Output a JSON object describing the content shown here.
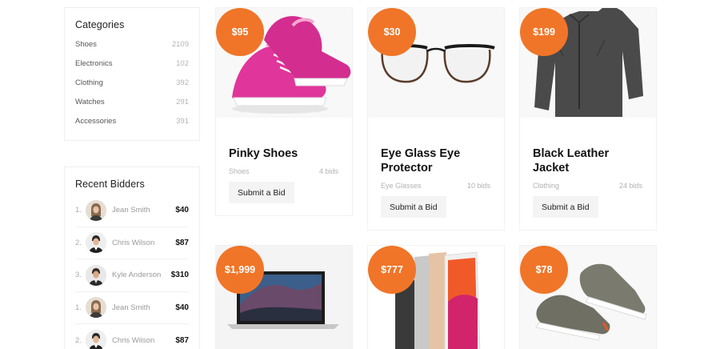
{
  "categories": {
    "title": "Categories",
    "items": [
      {
        "label": "Shoes",
        "count": "2109"
      },
      {
        "label": "Electronics",
        "count": "102"
      },
      {
        "label": "Clothing",
        "count": "392"
      },
      {
        "label": "Watches",
        "count": "291"
      },
      {
        "label": "Accessories",
        "count": "391"
      }
    ]
  },
  "recent_bidders": {
    "title": "Recent Bidders",
    "items": [
      {
        "rank": "1.",
        "name": "Jean Smith",
        "amount": "$40"
      },
      {
        "rank": "2.",
        "name": "Chris Wilson",
        "amount": "$87"
      },
      {
        "rank": "3.",
        "name": "Kyle Anderson",
        "amount": "$310"
      },
      {
        "rank": "1.",
        "name": "Jean Smith",
        "amount": "$40"
      },
      {
        "rank": "2.",
        "name": "Chris Wilson",
        "amount": "$87"
      }
    ]
  },
  "products": [
    {
      "price": "$95",
      "title": "Pinky Shoes",
      "category": "Shoes",
      "bids": "4 bids",
      "button": "Submit a Bid",
      "image_icon": "pink-sneakers"
    },
    {
      "price": "$30",
      "title": "Eye Glass Eye Protector",
      "category": "Eye Glasses",
      "bids": "10 bids",
      "button": "Submit a Bid",
      "image_icon": "eyeglasses"
    },
    {
      "price": "$199",
      "title": "Black Leather Jacket",
      "category": "Clothing",
      "bids": "24 bids",
      "button": "Submit a Bid",
      "image_icon": "jacket"
    },
    {
      "price": "$1,999",
      "image_icon": "laptop"
    },
    {
      "price": "$777",
      "image_icon": "tablets"
    },
    {
      "price": "$78",
      "image_icon": "grey-sneakers"
    }
  ],
  "colors": {
    "accent": "#f07528",
    "badge_text": "#ffffff",
    "muted_text": "#b2b2b2"
  }
}
